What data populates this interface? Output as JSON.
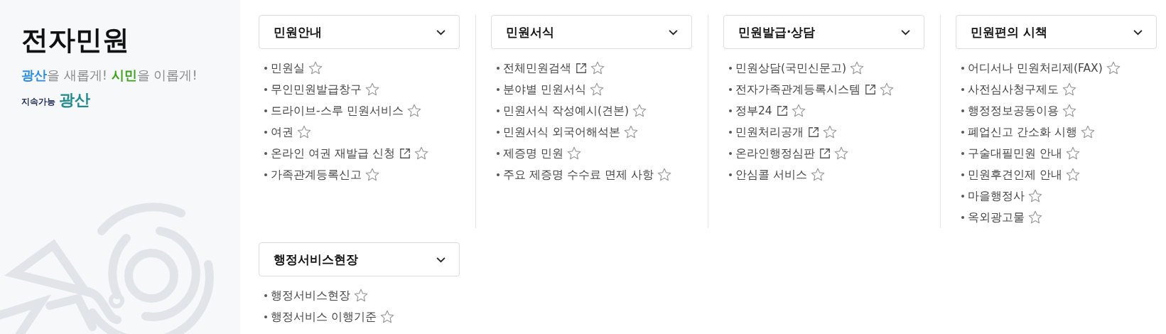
{
  "sidebar": {
    "title": "전자민원",
    "slogan": [
      {
        "text": "광산",
        "color": "#2a8de8"
      },
      {
        "text": "을 새롭게! ",
        "color": "#8a8a8a"
      },
      {
        "text": "시민",
        "color": "#3aa318"
      },
      {
        "text": "을 이롭게!",
        "color": "#8a8a8a"
      }
    ],
    "logo": {
      "prefix": "지속가능",
      "name": "광산"
    }
  },
  "menu_rows": [
    [
      {
        "title": "민원안내",
        "expanded": false,
        "items": [
          {
            "label": "민원실",
            "external": false,
            "favorite": false
          },
          {
            "label": "무인민원발급창구",
            "external": false,
            "favorite": false
          },
          {
            "label": "드라이브-스루 민원서비스",
            "external": false,
            "favorite": false
          },
          {
            "label": "여권",
            "external": false,
            "favorite": false
          },
          {
            "label": "온라인 여권 재발급 신청",
            "external": true,
            "favorite": false
          },
          {
            "label": "가족관계등록신고",
            "external": false,
            "favorite": false
          }
        ]
      },
      {
        "title": "민원서식",
        "expanded": false,
        "items": [
          {
            "label": "전체민원검색",
            "external": true,
            "favorite": false
          },
          {
            "label": "분야별 민원서식",
            "external": false,
            "favorite": false
          },
          {
            "label": "민원서식 작성예시(견본)",
            "external": false,
            "favorite": false
          },
          {
            "label": "민원서식 외국어해석본",
            "external": false,
            "favorite": false
          },
          {
            "label": "제증명 민원",
            "external": false,
            "favorite": false
          },
          {
            "label": "주요 제증명 수수료 면제 사항",
            "external": false,
            "favorite": false
          }
        ]
      },
      {
        "title": "민원발급·상담",
        "expanded": false,
        "items": [
          {
            "label": "민원상담(국민신문고)",
            "external": false,
            "favorite": false
          },
          {
            "label": "전자가족관계등록시스템",
            "external": true,
            "favorite": false
          },
          {
            "label": "정부24",
            "external": true,
            "favorite": false
          },
          {
            "label": "민원처리공개",
            "external": true,
            "favorite": false
          },
          {
            "label": "온라인행정심판",
            "external": true,
            "favorite": false
          },
          {
            "label": "안심콜 서비스",
            "external": false,
            "favorite": false
          }
        ]
      },
      {
        "title": "민원편의 시책",
        "expanded": false,
        "items": [
          {
            "label": "어디서나 민원처리제(FAX)",
            "external": false,
            "favorite": false
          },
          {
            "label": "사전심사청구제도",
            "external": false,
            "favorite": false
          },
          {
            "label": "행정정보공동이용",
            "external": false,
            "favorite": false
          },
          {
            "label": "폐업신고 간소화 시행",
            "external": false,
            "favorite": false
          },
          {
            "label": "구술대필민원 안내",
            "external": false,
            "favorite": false
          },
          {
            "label": "민원후견인제 안내",
            "external": false,
            "favorite": false
          },
          {
            "label": "마을행정사",
            "external": false,
            "favorite": false
          },
          {
            "label": "옥외광고물",
            "external": false,
            "favorite": false
          }
        ]
      }
    ],
    [
      {
        "title": "행정서비스현장",
        "expanded": false,
        "items": [
          {
            "label": "행정서비스현장",
            "external": false,
            "favorite": false
          },
          {
            "label": "행정서비스 이행기준",
            "external": false,
            "favorite": false
          }
        ]
      }
    ]
  ]
}
